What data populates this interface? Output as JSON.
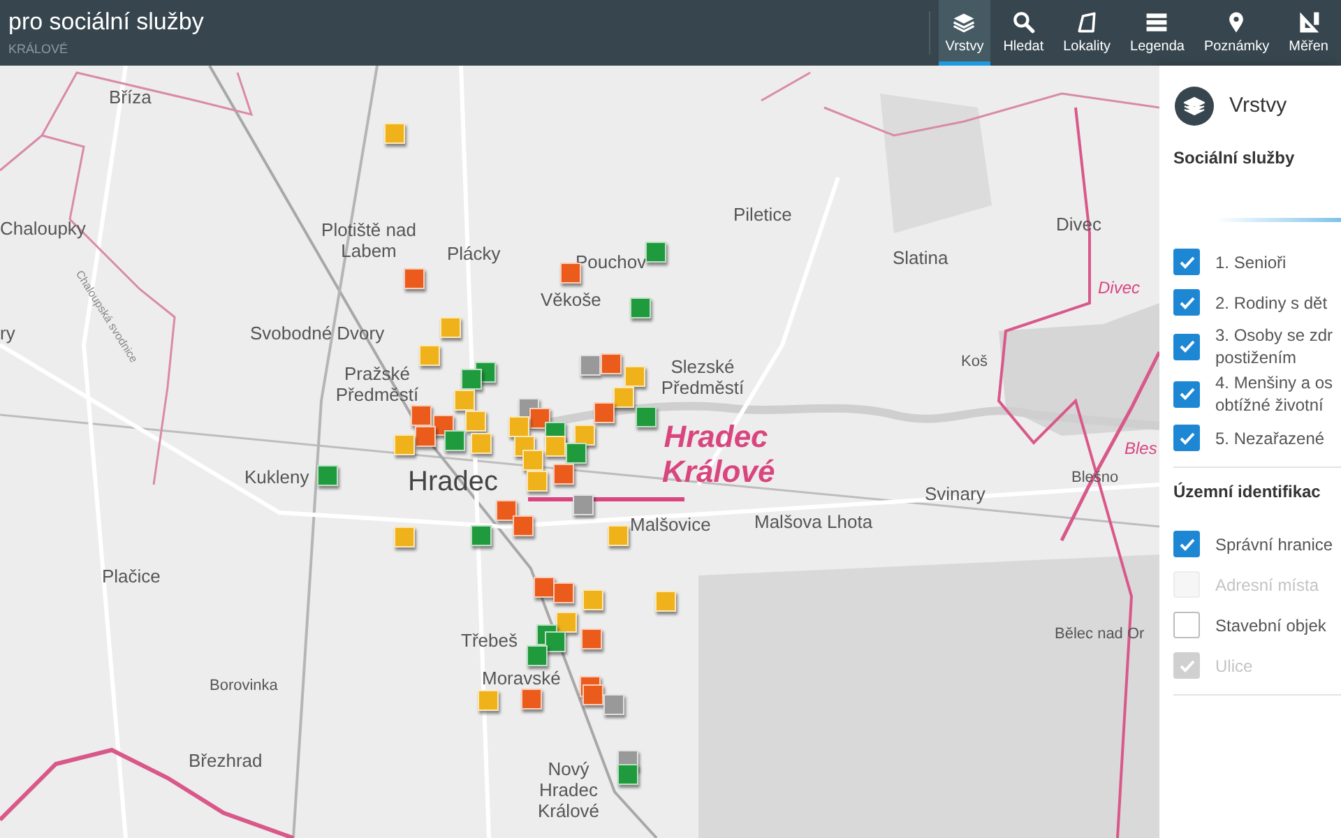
{
  "header": {
    "title": "pro sociální služby",
    "subtitle": "KRÁLOVÉ"
  },
  "toolbar": [
    {
      "label": "Vrstvy",
      "selected": true
    },
    {
      "label": "Hledat",
      "selected": false
    },
    {
      "label": "Lokality",
      "selected": false
    },
    {
      "label": "Legenda",
      "selected": false
    },
    {
      "label": "Poznámky",
      "selected": false
    },
    {
      "label": "Měřen",
      "selected": false
    }
  ],
  "map_labels": [
    {
      "text": "Bříza",
      "kind": "place"
    },
    {
      "text": "Chaloupky",
      "kind": "place"
    },
    {
      "text": "Plotiště nad Labem",
      "kind": "place"
    },
    {
      "text": "Plácky",
      "kind": "place"
    },
    {
      "text": "Pouchov",
      "kind": "place"
    },
    {
      "text": "Věkoše",
      "kind": "place"
    },
    {
      "text": "Piletice",
      "kind": "place"
    },
    {
      "text": "Slatina",
      "kind": "place"
    },
    {
      "text": "Divec",
      "kind": "place"
    },
    {
      "text": "Divec",
      "kind": "boundary"
    },
    {
      "text": "ry",
      "kind": "place"
    },
    {
      "text": "Svobodné Dvory",
      "kind": "place"
    },
    {
      "text": "Pražské Předměstí",
      "kind": "place"
    },
    {
      "text": "Slezské Předměstí",
      "kind": "place"
    },
    {
      "text": "Koš",
      "kind": "small"
    },
    {
      "text": "Kukleny",
      "kind": "place"
    },
    {
      "text": "Hradec",
      "kind": "city"
    },
    {
      "text": "Hradec Králové",
      "kind": "region"
    },
    {
      "text": "Malšovice",
      "kind": "place"
    },
    {
      "text": "Malšova Lhota",
      "kind": "place"
    },
    {
      "text": "Svinary",
      "kind": "place"
    },
    {
      "text": "Blešno",
      "kind": "small"
    },
    {
      "text": "Bles",
      "kind": "boundary"
    },
    {
      "text": "Plačice",
      "kind": "place"
    },
    {
      "text": "Bělec nad Or",
      "kind": "small"
    },
    {
      "text": "Borovinka",
      "kind": "small"
    },
    {
      "text": "Chaloupská svodnice",
      "kind": "water"
    },
    {
      "text": "Třebeš",
      "kind": "place"
    },
    {
      "text": "Moravské",
      "kind": "place"
    },
    {
      "text": "Nový Hradec Králové",
      "kind": "place"
    },
    {
      "text": "Březhrad",
      "kind": "place"
    }
  ],
  "markers": [
    {
      "color": "#f0b21a"
    },
    {
      "color": "#ea5b1c"
    },
    {
      "color": "#ea5b1c"
    },
    {
      "color": "#1f9a3c"
    },
    {
      "color": "#1f9a3c"
    },
    {
      "color": "#f0b21a"
    },
    {
      "color": "#f0b21a"
    },
    {
      "color": "#1f9a3c"
    },
    {
      "color": "#1f9a3c"
    },
    {
      "color": "#999999"
    },
    {
      "color": "#ea5b1c"
    },
    {
      "color": "#f0b21a"
    },
    {
      "color": "#f0b21a"
    },
    {
      "color": "#ea5b1c"
    },
    {
      "color": "#1f9a3c"
    },
    {
      "color": "#f0b21a"
    },
    {
      "color": "#ea5b1c"
    },
    {
      "color": "#ea5b1c"
    },
    {
      "color": "#f0b21a"
    },
    {
      "color": "#ea5b1c"
    },
    {
      "color": "#f0b21a"
    },
    {
      "color": "#1f9a3c"
    },
    {
      "color": "#f0b21a"
    },
    {
      "color": "#999999"
    },
    {
      "color": "#ea5b1c"
    },
    {
      "color": "#f0b21a"
    },
    {
      "color": "#1f9a3c"
    },
    {
      "color": "#f0b21a"
    },
    {
      "color": "#f0b21a"
    },
    {
      "color": "#f0b21a"
    },
    {
      "color": "#1f9a3c"
    },
    {
      "color": "#f0b21a"
    },
    {
      "color": "#ea5b1c"
    },
    {
      "color": "#f0b21a"
    },
    {
      "color": "#1f9a3c"
    },
    {
      "color": "#999999"
    },
    {
      "color": "#ea5b1c"
    },
    {
      "color": "#ea5b1c"
    },
    {
      "color": "#1f9a3c"
    },
    {
      "color": "#f0b21a"
    },
    {
      "color": "#f0b21a"
    },
    {
      "color": "#ea5b1c"
    },
    {
      "color": "#ea5b1c"
    },
    {
      "color": "#f0b21a"
    },
    {
      "color": "#f0b21a"
    },
    {
      "color": "#f0b21a"
    },
    {
      "color": "#1f9a3c"
    },
    {
      "color": "#1f9a3c"
    },
    {
      "color": "#1f9a3c"
    },
    {
      "color": "#ea5b1c"
    },
    {
      "color": "#f0b21a"
    },
    {
      "color": "#ea5b1c"
    },
    {
      "color": "#ea5b1c"
    },
    {
      "color": "#ea5b1c"
    },
    {
      "color": "#999999"
    },
    {
      "color": "#999999"
    },
    {
      "color": "#1f9a3c"
    }
  ],
  "panel": {
    "title": "Vrstvy",
    "sections": [
      {
        "title": "Sociální služby",
        "items": [
          {
            "label": "1. Senioři",
            "checked": true,
            "disabled": false
          },
          {
            "label": "2. Rodiny s dět",
            "checked": true,
            "disabled": false
          },
          {
            "label": "3. Osoby se zdr postižením",
            "checked": true,
            "disabled": false
          },
          {
            "label": "4. Menšiny a os obtížné životní",
            "checked": true,
            "disabled": false
          },
          {
            "label": "5. Nezařazené",
            "checked": true,
            "disabled": false
          }
        ]
      },
      {
        "title": "Územní identifikac",
        "items": [
          {
            "label": "Správní hranice",
            "checked": true,
            "disabled": false
          },
          {
            "label": "Adresní místa",
            "checked": false,
            "disabled": true
          },
          {
            "label": "Stavební objek",
            "checked": false,
            "disabled": false
          },
          {
            "label": "Ulice",
            "checked": true,
            "disabled": true
          }
        ]
      }
    ]
  }
}
